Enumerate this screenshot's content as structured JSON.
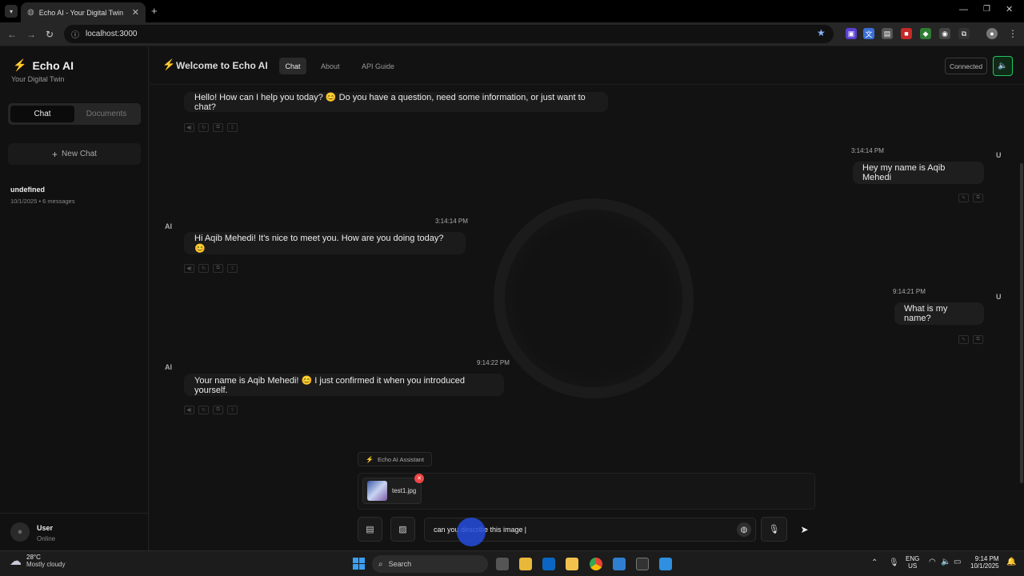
{
  "browser": {
    "tab_title": "Echo AI - Your Digital Twin",
    "url": "localhost:3000"
  },
  "sidebar": {
    "app_name": "Echo AI",
    "app_subtitle": "Your Digital Twin",
    "tabs": [
      {
        "label": "Chat"
      },
      {
        "label": "Documents"
      }
    ],
    "new_chat_label": "New Chat",
    "history": [
      {
        "title": "undefined",
        "meta": "10/1/2025 • 6 messages"
      }
    ],
    "user": {
      "name": "User",
      "status": "Online"
    }
  },
  "header": {
    "title": "Welcome to Echo AI",
    "nav": [
      {
        "label": "Chat"
      },
      {
        "label": "About"
      },
      {
        "label": "API Guide"
      }
    ],
    "status": "Connected"
  },
  "messages": [
    {
      "role": "ai",
      "who": "AI",
      "text": "Hello! How can I help you today? 😊 Do you have a question, need some information, or just want to chat?",
      "time": ""
    },
    {
      "role": "user",
      "who": "U",
      "text": "Hey my name is Aqib Mehedi",
      "time": "3:14:14 PM"
    },
    {
      "role": "ai",
      "who": "AI",
      "text": "Hi Aqib Mehedi! It's nice to meet you. How are you doing today? 😊",
      "time": "3:14:14 PM"
    },
    {
      "role": "user",
      "who": "U",
      "text": "What is my name?",
      "time": "9:14:21 PM"
    },
    {
      "role": "ai",
      "who": "AI",
      "text": "Your name is Aqib Mehedi! 😊 I just confirmed it when you introduced yourself.",
      "time": "9:14:22 PM"
    }
  ],
  "composer": {
    "assistant_label": "Echo AI Assistant",
    "attachment_name": "test1.jpg",
    "input_value": "can you describe this image"
  },
  "taskbar": {
    "weather_temp": "28°C",
    "weather_desc": "Mostly cloudy",
    "search_label": "Search",
    "lang_top": "ENG",
    "lang_bottom": "US",
    "time": "9:14 PM",
    "date": "10/1/2025"
  },
  "colors": {
    "accent_orange": "#f97316",
    "connected_green": "#22c55e",
    "remove_red": "#ef4444",
    "send_blue": "#1d4ed8"
  }
}
